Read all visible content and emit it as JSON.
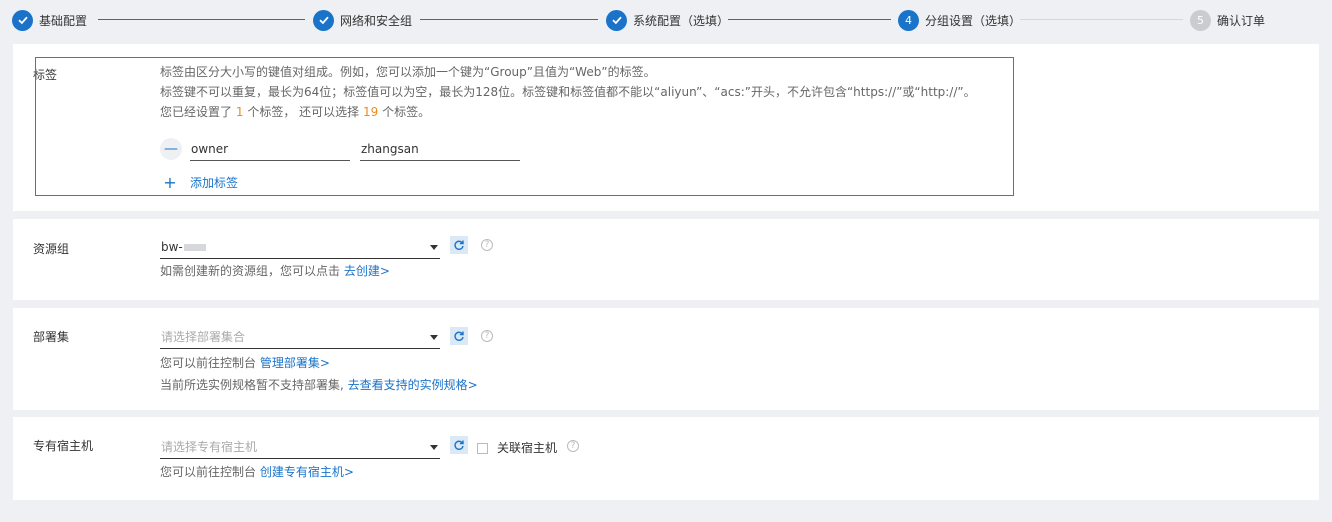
{
  "stepper": {
    "steps": [
      {
        "label": "基础配置",
        "state": "done"
      },
      {
        "label": "网络和安全组",
        "state": "done"
      },
      {
        "label": "系统配置（选填）",
        "state": "done"
      },
      {
        "number": "4",
        "label": "分组设置（选填）",
        "state": "active"
      },
      {
        "number": "5",
        "label": "确认订单",
        "state": "pending"
      }
    ]
  },
  "tags": {
    "label": "标签",
    "desc_line1": "标签由区分大小写的键值对组成。例如，您可以添加一个键为“Group”且值为“Web”的标签。",
    "desc_line2": "标签键不可以重复，最长为64位；标签值可以为空，最长为128位。标签键和标签值都不能以“aliyun”、“acs:”开头，不允许包含“https://”或“http://”。",
    "count_prefix": "您已经设置了",
    "count_set": "1",
    "count_mid": "个标签， 还可以选择",
    "count_remaining": "19",
    "count_suffix": "个标签。",
    "remove_symbol": "—",
    "items": [
      {
        "key": "owner",
        "value": "zhangsan"
      }
    ],
    "add_label": "添加标签",
    "add_symbol": "+"
  },
  "resource_group": {
    "label": "资源组",
    "value": "bw-",
    "hint_text": "如需创建新的资源组，您可以点击",
    "hint_link": "去创建>"
  },
  "deployment_set": {
    "label": "部署集",
    "placeholder": "请选择部署集合",
    "hint1_text": "您可以前往控制台",
    "hint1_link": "管理部署集>",
    "hint2_text": "当前所选实例规格暂不支持部署集,",
    "hint2_link": "去查看支持的实例规格>"
  },
  "dedicated_host": {
    "label": "专有宿主机",
    "placeholder": "请选择专有宿主机",
    "checkbox_label": "关联宿主机",
    "hint_text": "您可以前往控制台",
    "hint_link": "创建专有宿主机>"
  },
  "help_symbol": "?",
  "colors": {
    "primary": "#1a73c9",
    "highlight": "#e0432c",
    "count": "#f08a1c",
    "page_bg": "#eef0f3"
  }
}
